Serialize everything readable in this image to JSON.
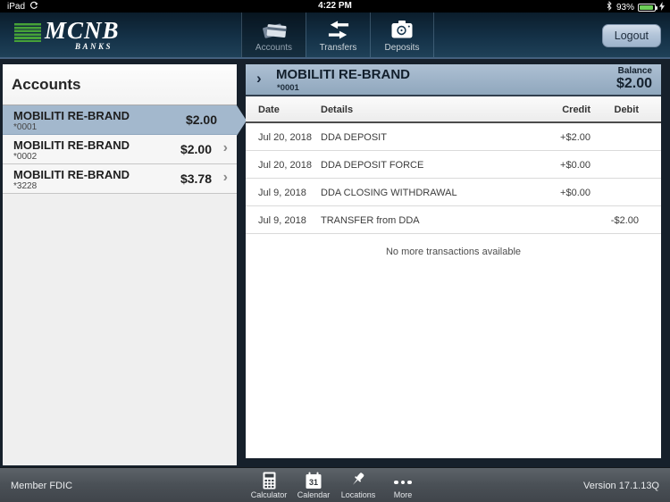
{
  "status_bar": {
    "device": "iPad",
    "time": "4:22 PM",
    "battery_percent": "93%",
    "icons": [
      "orientation-lock-icon",
      "bluetooth-icon",
      "battery-icon",
      "charging-bolt-icon"
    ]
  },
  "header": {
    "logo": {
      "name": "MCNB",
      "sub": "BANKS"
    },
    "tabs": [
      {
        "label": "Accounts",
        "icon": "card-icon",
        "selected": true
      },
      {
        "label": "Transfers",
        "icon": "transfer-arrows-icon",
        "selected": false
      },
      {
        "label": "Deposits",
        "icon": "camera-icon",
        "selected": false
      }
    ],
    "logout_label": "Logout"
  },
  "sidebar": {
    "title": "Accounts",
    "accounts": [
      {
        "name": "MOBILITI RE-BRAND",
        "number": "*0001",
        "amount": "$2.00",
        "selected": true
      },
      {
        "name": "MOBILITI RE-BRAND",
        "number": "*0002",
        "amount": "$2.00",
        "selected": false
      },
      {
        "name": "MOBILITI RE-BRAND",
        "number": "*3228",
        "amount": "$3.78",
        "selected": false
      }
    ]
  },
  "main": {
    "account_header": {
      "name": "MOBILITI RE-BRAND",
      "number": "*0001",
      "balance_label": "Balance",
      "balance": "$2.00"
    },
    "table": {
      "columns": [
        "Date",
        "Details",
        "Credit",
        "Debit"
      ],
      "rows": [
        {
          "date": "Jul 20, 2018",
          "details": "DDA DEPOSIT",
          "credit": "+$2.00",
          "debit": ""
        },
        {
          "date": "Jul 20, 2018",
          "details": "DDA DEPOSIT FORCE",
          "credit": "+$0.00",
          "debit": ""
        },
        {
          "date": "Jul 9, 2018",
          "details": "DDA CLOSING WITHDRAWAL",
          "credit": "+$0.00",
          "debit": ""
        },
        {
          "date": "Jul 9, 2018",
          "details": "TRANSFER from DDA",
          "credit": "",
          "debit": "-$2.00"
        }
      ],
      "empty_message": "No more transactions available"
    }
  },
  "footer": {
    "left_text": "Member FDIC",
    "tools": [
      {
        "label": "Calculator",
        "icon": "calculator-icon"
      },
      {
        "label": "Calendar",
        "icon": "calendar-icon",
        "day": "31"
      },
      {
        "label": "Locations",
        "icon": "pushpin-icon"
      },
      {
        "label": "More",
        "icon": "ellipsis-icon"
      }
    ],
    "version": "Version 17.1.13Q"
  },
  "icons": {
    "chevron": "›"
  },
  "colors": {
    "brand_green": "#46a238",
    "header_navy": "#1f4158",
    "selected_blue": "#a3b8cd",
    "battery_green": "#6ecf58",
    "footer_slate": "#4b5157",
    "content_dark": "#16202b"
  }
}
